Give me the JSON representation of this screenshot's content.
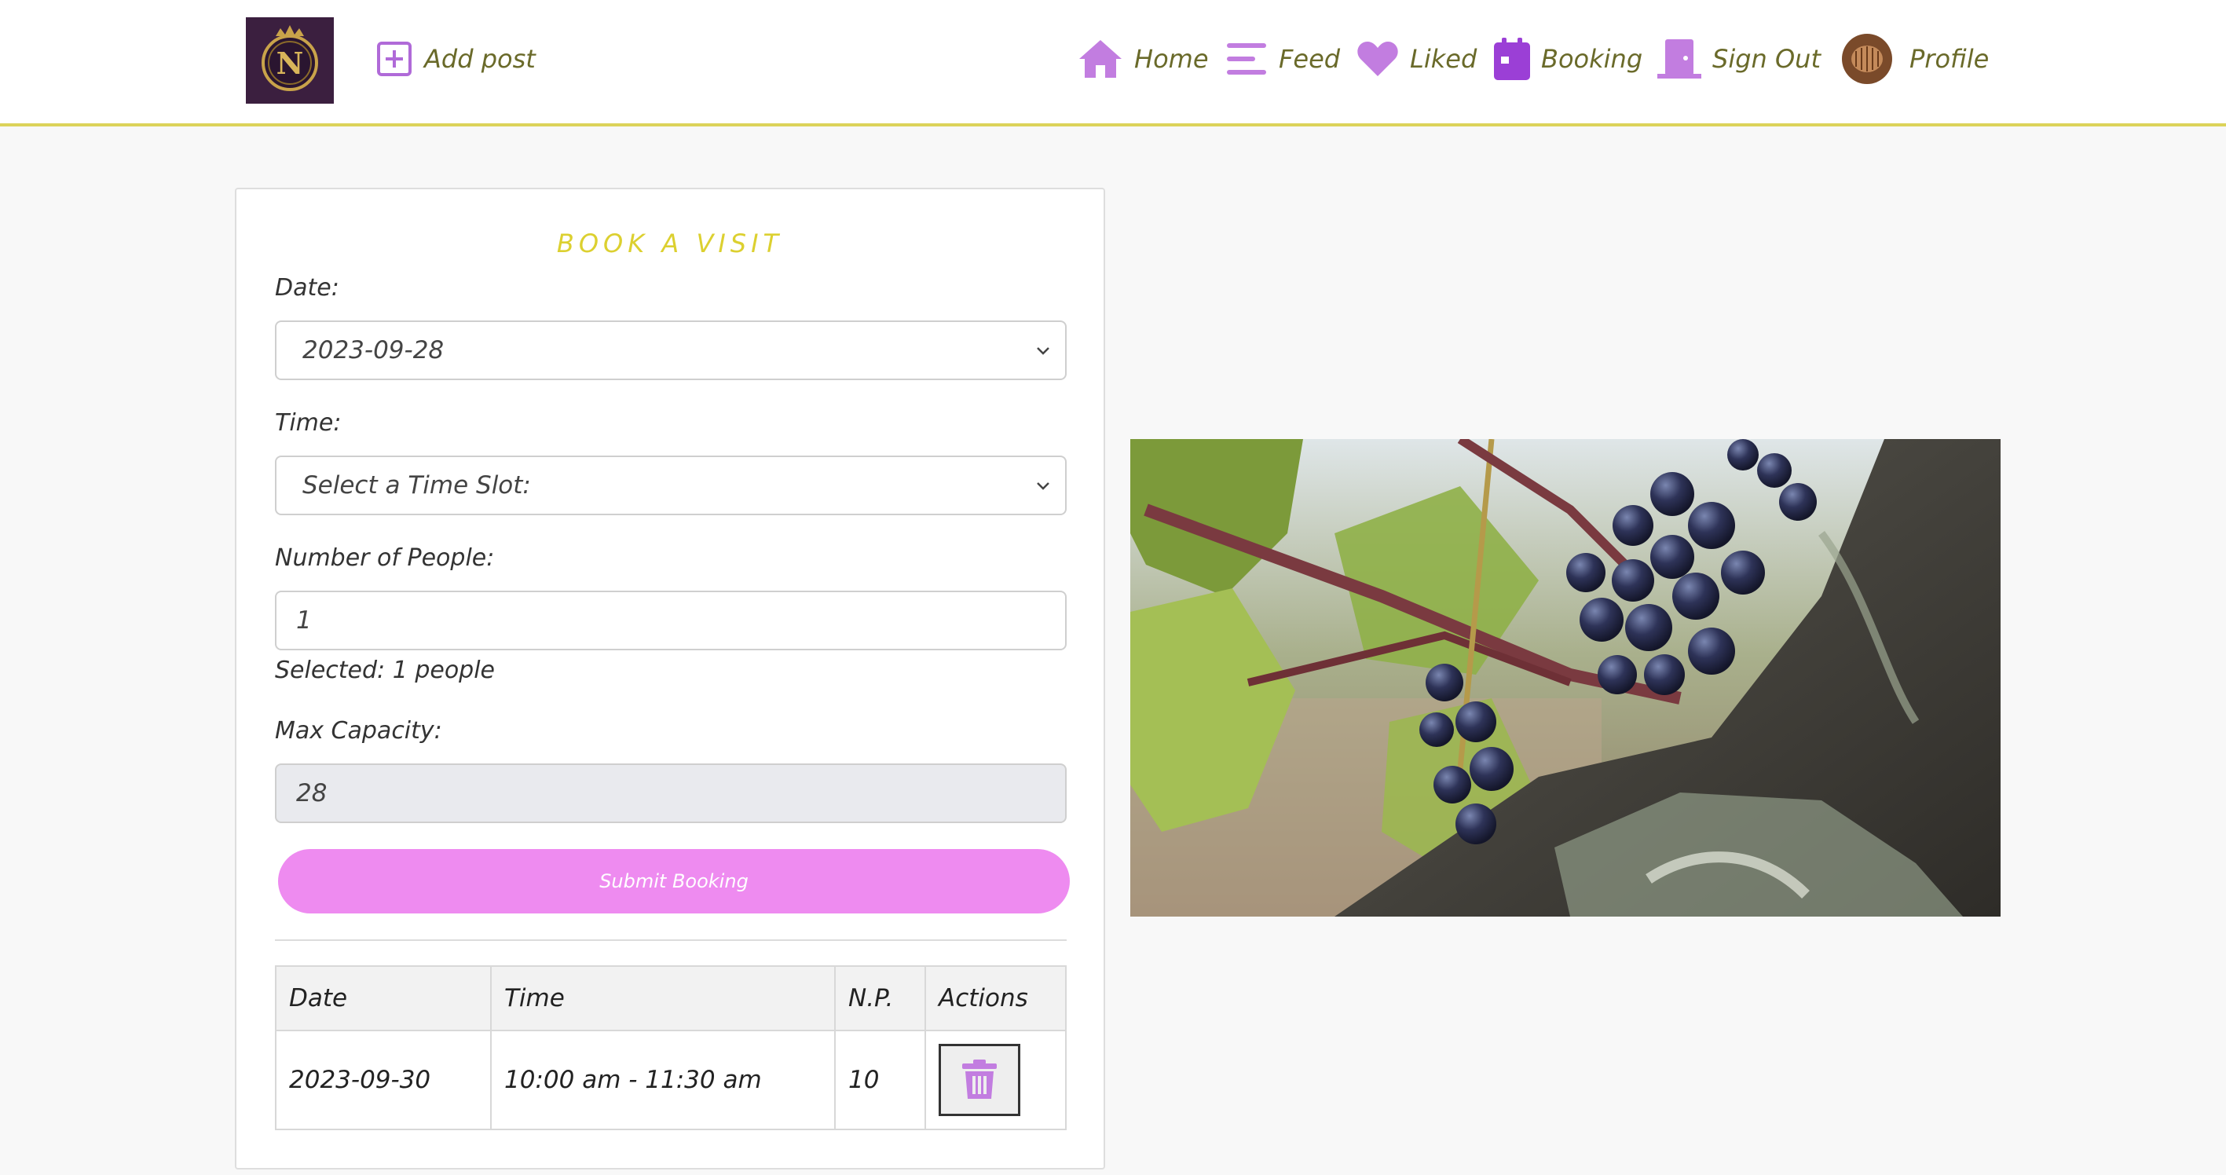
{
  "nav": {
    "add_post": "Add post",
    "home": "Home",
    "feed": "Feed",
    "liked": "Liked",
    "booking": "Booking",
    "sign_out": "Sign Out",
    "profile": "Profile",
    "logo_letter": "N"
  },
  "form": {
    "title": "BOOK A VISIT",
    "date_label": "Date:",
    "date_value": "2023-09-28",
    "time_label": "Time:",
    "time_value": "Select a Time Slot:",
    "people_label": "Number of People:",
    "people_value": "1",
    "selected_text": "Selected: 1 people",
    "capacity_label": "Max Capacity:",
    "capacity_value": "28",
    "submit_label": "Submit Booking"
  },
  "table": {
    "headers": [
      "Date",
      "Time",
      "N.P.",
      "Actions"
    ],
    "rows": [
      {
        "date": "2023-09-30",
        "time": "10:00 am - 11:30 am",
        "np": "10"
      }
    ]
  },
  "colors": {
    "accent_purple": "#9b3fd6",
    "icon_lilac": "#c27de0",
    "title_yellow": "#dcd030",
    "nav_text": "#6a6a2a",
    "submit_pink": "#ee8bf0"
  }
}
